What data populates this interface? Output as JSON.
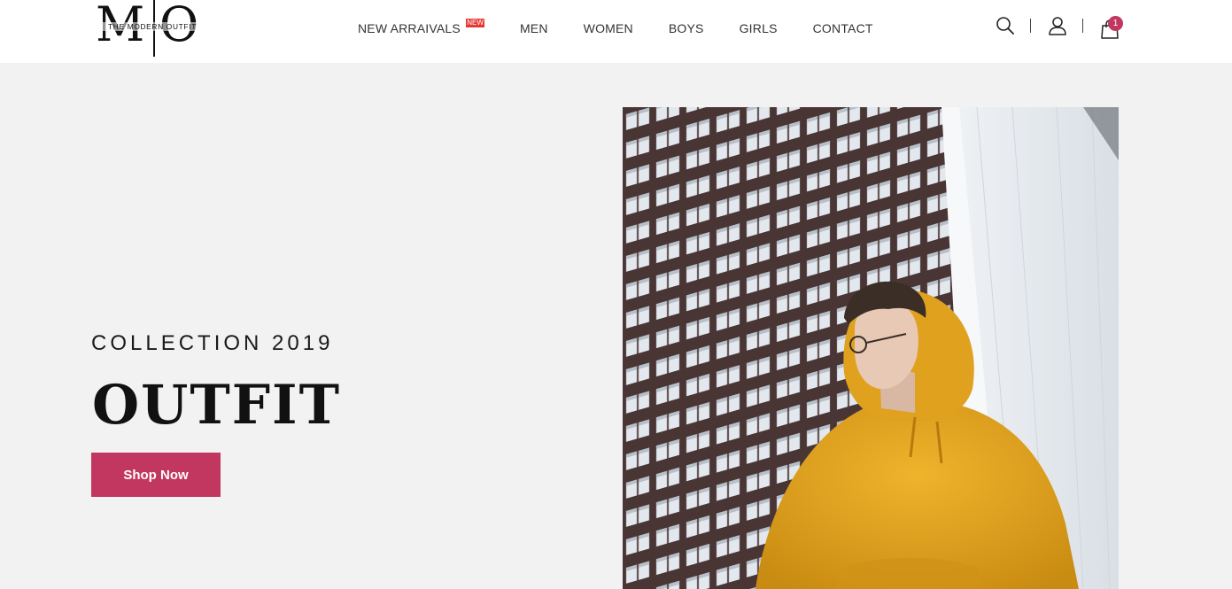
{
  "brand": {
    "letter_left": "M",
    "letter_right": "O",
    "tagline": "THE MODERN OUTFIT"
  },
  "nav": {
    "items": [
      {
        "label": "NEW ARRAIVALS",
        "badge": "NEW"
      },
      {
        "label": "MEN"
      },
      {
        "label": "WOMEN"
      },
      {
        "label": "BOYS"
      },
      {
        "label": "GIRLS"
      },
      {
        "label": "CONTACT"
      }
    ]
  },
  "tools": {
    "icons": [
      "search-icon",
      "user-icon",
      "shopping-bag-icon"
    ],
    "cart_count": "1"
  },
  "hero": {
    "eyebrow": "COLLECTION 2019",
    "title": "OUTFIT",
    "cta": "Shop Now",
    "image": "man-in-yellow-hoodie-in-front-of-building"
  },
  "colors": {
    "accent": "#c2375f",
    "badge": "#e53935",
    "hoodie": "#e8a823",
    "background": "#f2f2f2"
  }
}
